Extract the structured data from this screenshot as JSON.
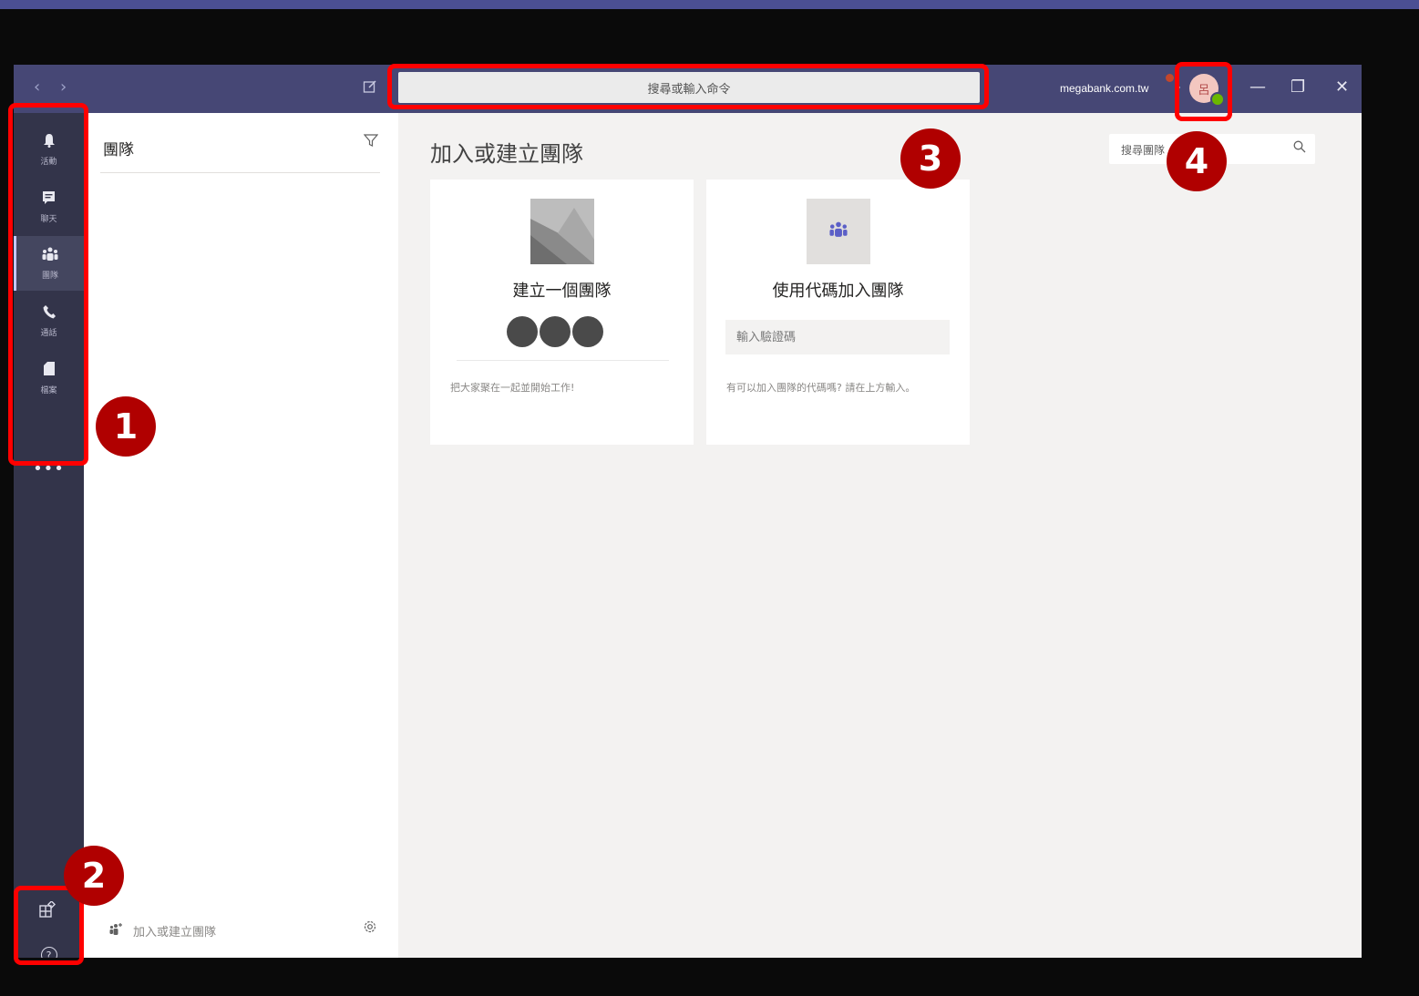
{
  "titlebar": {
    "back": "‹",
    "forward": "›",
    "compose_icon": "compose-icon",
    "search_placeholder": "搜尋或輸入命令",
    "tenant": "megabank.com.tw",
    "avatar_initial": "呂",
    "minimize": "—",
    "maximize": "❐",
    "close": "✕"
  },
  "rail": {
    "items": [
      {
        "label": "活動",
        "icon": "bell-icon"
      },
      {
        "label": "聊天",
        "icon": "chat-icon"
      },
      {
        "label": "團隊",
        "icon": "teams-icon"
      },
      {
        "label": "通話",
        "icon": "phone-icon"
      },
      {
        "label": "檔案",
        "icon": "file-icon"
      }
    ],
    "more": "•••",
    "store": "市集",
    "help": "說明"
  },
  "list": {
    "title": "團隊",
    "join_create": "加入或建立團隊"
  },
  "main": {
    "title": "加入或建立團隊",
    "search_placeholder": "搜尋團隊",
    "create_card": {
      "title": "建立一個團隊",
      "desc": "把大家聚在一起並開始工作!"
    },
    "join_card": {
      "title": "使用代碼加入團隊",
      "input_placeholder": "輸入驗證碼",
      "desc": "有可以加入團隊的代碼嗎? 請在上方輸入。"
    }
  },
  "annotations": [
    "1",
    "2",
    "3",
    "4"
  ],
  "colors": {
    "titlebar": "#464775",
    "rail": "#33344a",
    "highlight": "#ff0000",
    "badge": "#b00000"
  }
}
